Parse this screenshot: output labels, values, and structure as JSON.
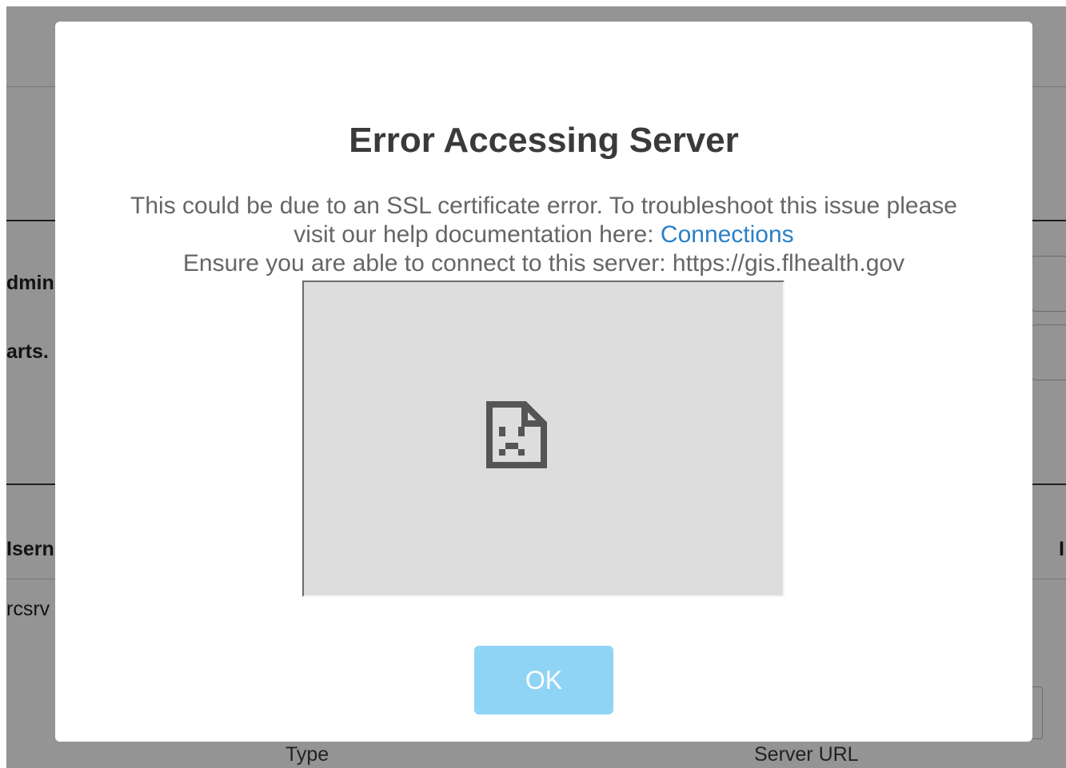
{
  "background": {
    "label_admin": "dmini",
    "label_charts": "arts.",
    "label_username": "Isern",
    "cell_user": "rcsrv",
    "right_marker": "I",
    "column_type": "Type",
    "column_server_url": "Server URL"
  },
  "dialog": {
    "title": "Error Accessing Server",
    "line1": "This could be due to an SSL certificate error. To troubleshoot this issue please",
    "line2_prefix": "visit our help documentation here: ",
    "line2_link": "Connections",
    "line3": "Ensure you are able to connect to this server: https://gis.flhealth.gov",
    "embedded_frame_icon": "sad-file-icon",
    "ok_label": "OK"
  },
  "colors": {
    "overlay": "rgba(0,0,0,0.42)",
    "link": "#2a7fc8",
    "ok_button": "#8fd4f4",
    "frame_bg": "#dddddd"
  }
}
